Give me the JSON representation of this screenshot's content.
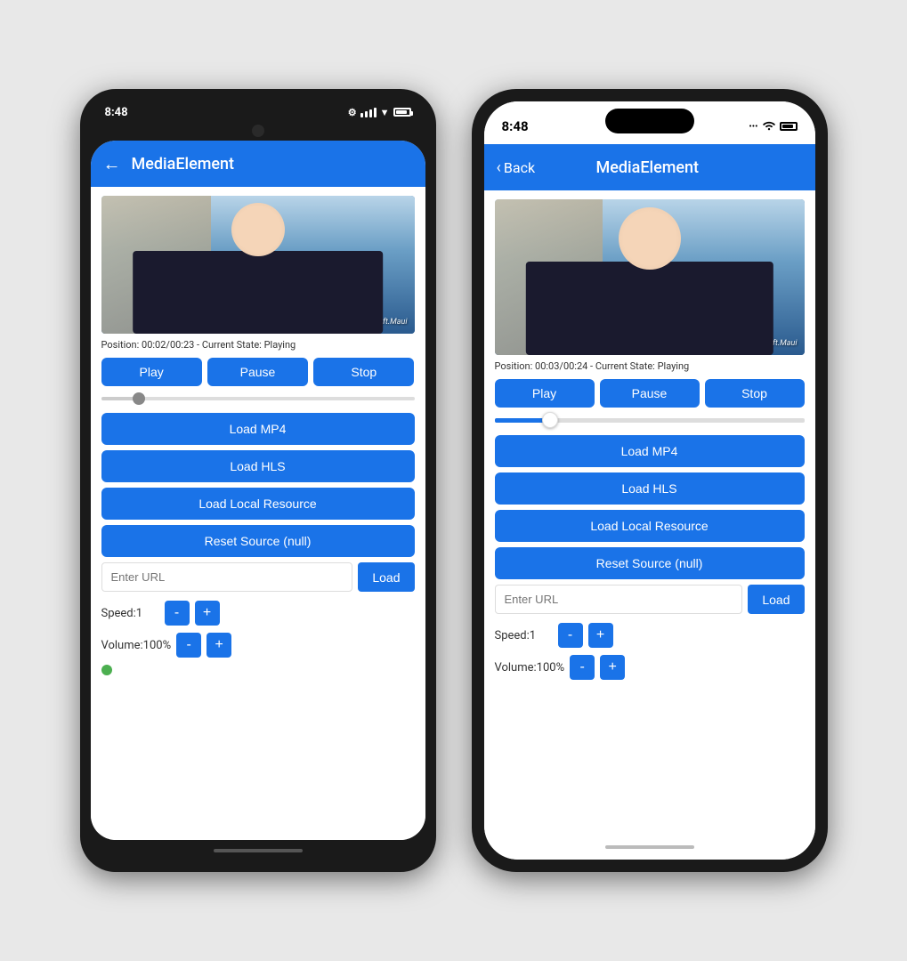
{
  "android": {
    "statusBar": {
      "time": "8:48",
      "settingsIcon": "⚙",
      "signalIcon": "▼",
      "wifiIcon": "WiFi",
      "batteryIcon": "Battery"
    },
    "toolbar": {
      "backLabel": "←",
      "title": "MediaElement"
    },
    "video": {
      "statusText": "Position: 00:02/00:23 - Current State: Playing",
      "overlay": "using Microsoft.Maui"
    },
    "controls": {
      "playLabel": "Play",
      "pauseLabel": "Pause",
      "stopLabel": "Stop"
    },
    "buttons": {
      "loadMp4": "Load MP4",
      "loadHls": "Load HLS",
      "loadLocal": "Load Local Resource",
      "resetSource": "Reset Source (null)"
    },
    "urlInput": {
      "placeholder": "Enter URL",
      "loadLabel": "Load"
    },
    "speed": {
      "label": "Speed:1",
      "minusLabel": "-",
      "plusLabel": "+"
    },
    "volume": {
      "label": "Volume:100%",
      "minusLabel": "-",
      "plusLabel": "+"
    }
  },
  "iphone": {
    "statusBar": {
      "time": "8:48",
      "wifiLabel": "WiFi",
      "batteryLabel": "Battery"
    },
    "toolbar": {
      "backLabel": "Back",
      "title": "MediaElement"
    },
    "video": {
      "statusText": "Position: 00:03/00:24 - Current State: Playing",
      "overlay": "using Microsoft.Maui"
    },
    "controls": {
      "playLabel": "Play",
      "pauseLabel": "Pause",
      "stopLabel": "Stop"
    },
    "buttons": {
      "loadMp4": "Load MP4",
      "loadHls": "Load HLS",
      "loadLocal": "Load Local Resource",
      "resetSource": "Reset Source (null)"
    },
    "urlInput": {
      "placeholder": "Enter URL",
      "loadLabel": "Load"
    },
    "speed": {
      "label": "Speed:1",
      "minusLabel": "-",
      "plusLabel": "+"
    },
    "volume": {
      "label": "Volume:100%",
      "minusLabel": "-",
      "plusLabel": "+"
    }
  },
  "colors": {
    "accent": "#1a73e8",
    "bg": "#e8e8e8"
  }
}
